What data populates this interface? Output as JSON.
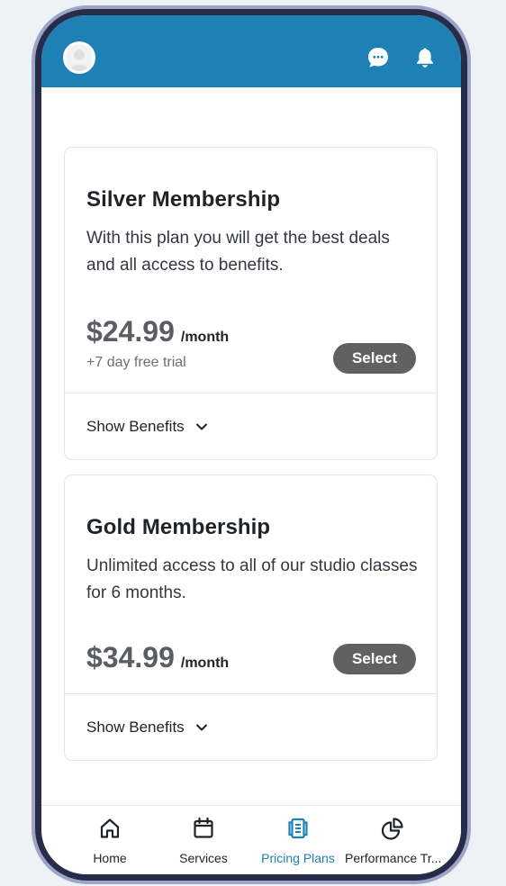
{
  "header": {
    "avatar_icon": "user-avatar",
    "chat_icon": "chat-bubble-icon",
    "notifications_icon": "bell-icon",
    "color": "#1f80b6"
  },
  "plans": [
    {
      "title": "Silver Membership",
      "description": "With this plan you will get the best deals and all access to benefits.",
      "price": "$24.99",
      "period": "/month",
      "trial": "+7 day free trial",
      "select_label": "Select",
      "benefits_label": "Show Benefits"
    },
    {
      "title": "Gold Membership",
      "description": "Unlimited access to all of our studio classes for 6 months.",
      "price": "$34.99",
      "period": "/month",
      "select_label": "Select",
      "benefits_label": "Show Benefits"
    }
  ],
  "bottom_nav": {
    "active": "Pricing Plans",
    "active_color": "#1f80b6",
    "items": [
      {
        "label": "Home",
        "icon": "home-icon"
      },
      {
        "label": "Services",
        "icon": "calendar-icon"
      },
      {
        "label": "Pricing Plans",
        "icon": "document-list-icon"
      },
      {
        "label": "Performance Tr...",
        "icon": "pie-chart-icon"
      }
    ]
  }
}
